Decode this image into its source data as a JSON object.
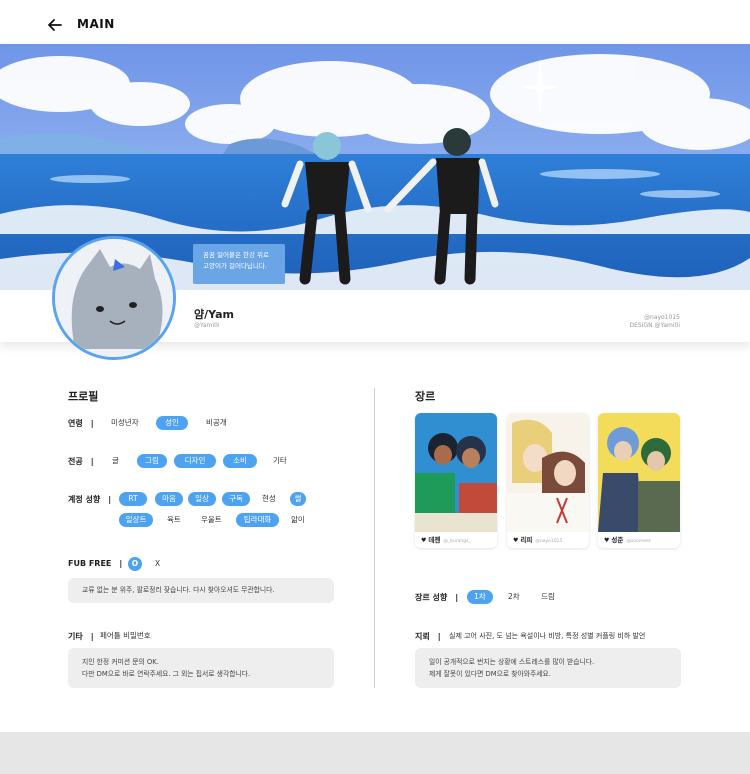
{
  "topbar": {
    "title": "MAIN",
    "back_icon": "arrow-left-icon"
  },
  "banner": {
    "speech_lines": [
      "꿈꿈 잃어붙은 한강 위로",
      "고양이가 걸어다닙니다."
    ]
  },
  "profile": {
    "name": "얌/Yam",
    "handle": "@Yami0i",
    "credit_art": "@nayo1015",
    "credit_design": "DESIGN @Yami0i"
  },
  "left": {
    "title": "프로필",
    "age": {
      "label": "연령",
      "opts": [
        "미성년자",
        "성인",
        "비공개"
      ]
    },
    "major": {
      "label": "전공",
      "opts": [
        "글",
        "그림",
        "디자인",
        "소비",
        "기타"
      ]
    },
    "tendency": {
      "label": "계정 성향",
      "row1": [
        "RT",
        "마음",
        "일상",
        "구독",
        "현성",
        "썰"
      ],
      "row2": [
        "일상트",
        "육트",
        "우울트",
        "팁라대화",
        "앎이"
      ]
    },
    "fub": {
      "label": "FUB FREE",
      "opts": [
        "O",
        "X"
      ],
      "note": "교류 없는 분 위주, 팔로정리 잦습니다. 다시 찾아오셔도 무관합니다."
    },
    "etc": {
      "label": "기타",
      "value": "페어틀 비밀번호",
      "note_lines": [
        "지인 한정 커미션 문의 OK.",
        "다만 DM으로 바로 연락주세요. 그 외는 핍서로 생각합니다."
      ]
    }
  },
  "right": {
    "title": "장르",
    "cards": [
      {
        "name": "데젠",
        "handle": "@_burangs_"
      },
      {
        "name": "리피",
        "handle": "@nayo1015"
      },
      {
        "name": "성준",
        "handle": "@zoomeec"
      }
    ],
    "genre_tendency": {
      "label": "장르 성향",
      "opts": [
        "1차",
        "2차",
        "드림"
      ]
    },
    "mine": {
      "label": "지뢰",
      "value": "실제 고어 사진, 도 넘는 욕설이나 비방, 특정 성별 커플링 비하 발언",
      "note_lines": [
        "일이 공개적으로 번지는 상황에 스트레스를 많이 받습니다.",
        "제게 잘못이 있다면 DM으로 찾아와주세요."
      ]
    }
  },
  "colors": {
    "accent": "#4ea3f0",
    "ring": "#5aa3ee",
    "note_bg": "#eeeeee"
  }
}
